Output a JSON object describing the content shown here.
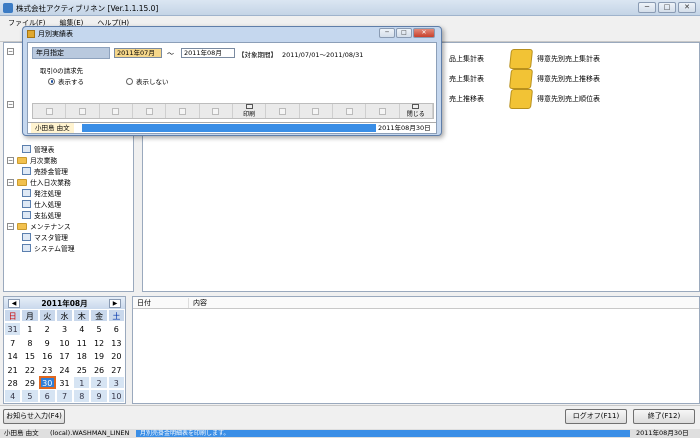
{
  "app": {
    "title": "株式会社アクティブリネン  [Ver.1.1.15.0]"
  },
  "window_controls": {
    "minimize": "─",
    "restore": "□",
    "close": "✕"
  },
  "menu": [
    {
      "label": "ファイル(F)"
    },
    {
      "label": "編集(E)"
    },
    {
      "label": "ヘルプ(H)"
    }
  ],
  "tree": {
    "items": [
      {
        "label": "管理表",
        "kind": "doc"
      },
      {
        "label": "月次業務",
        "kind": "folder"
      },
      {
        "label": "売掛金管理",
        "kind": "doc"
      },
      {
        "label": "仕入日次業務",
        "kind": "folder"
      },
      {
        "label": "発注処理",
        "kind": "doc"
      },
      {
        "label": "仕入処理",
        "kind": "doc"
      },
      {
        "label": "支払処理",
        "kind": "doc"
      },
      {
        "label": "メンテナンス",
        "kind": "folder"
      },
      {
        "label": "マスタ管理",
        "kind": "doc"
      },
      {
        "label": "システム管理",
        "kind": "doc"
      }
    ]
  },
  "reports": {
    "col1": [
      "品上集計表",
      "売上集計表",
      "売上推移表"
    ],
    "col2": [
      "得意先別売上集計表",
      "得意先別売上推移表",
      "得意先別売上順位表"
    ]
  },
  "calendar": {
    "month_label": "2011年08月",
    "prev": "◀",
    "next": "▶",
    "weekdays": [
      "日",
      "月",
      "火",
      "水",
      "木",
      "金",
      "土"
    ],
    "weeks": [
      [
        "31",
        "1",
        "2",
        "3",
        "4",
        "5",
        "6"
      ],
      [
        "7",
        "8",
        "9",
        "10",
        "11",
        "12",
        "13"
      ],
      [
        "14",
        "15",
        "16",
        "17",
        "18",
        "19",
        "20"
      ],
      [
        "21",
        "22",
        "23",
        "24",
        "25",
        "26",
        "27"
      ],
      [
        "28",
        "29",
        "30",
        "31",
        "1",
        "2",
        "3"
      ],
      [
        "4",
        "5",
        "6",
        "7",
        "8",
        "9",
        "10"
      ]
    ],
    "selected": "30"
  },
  "info": {
    "col_date": "日付",
    "col_content": "内容"
  },
  "bottom": {
    "notice_button": "お知らせ入力(F4)",
    "logout_button": "ログオフ(F11)",
    "exit_button": "終了(F12)"
  },
  "status": {
    "user": "小田島  由文",
    "server": "(local).WASHMAN_LINEN",
    "message": "月別売掛金明細表を印刷します。",
    "date": "2011年08月30日"
  },
  "dialog": {
    "title": "月別実績表",
    "period_label": "年月指定",
    "from_value": "2011年07月",
    "tilde": "～",
    "to_value": "2011年08月",
    "period_tag": "【対象期間】",
    "period_range": "2011/07/01～2011/08/31",
    "group_label": "取引0の請求先",
    "radio_show": "表示する",
    "radio_hide": "表示しない",
    "fkeys": [
      "",
      "",
      "",
      "",
      "",
      "",
      "印刷",
      "",
      "",
      "",
      "",
      "閉じる"
    ],
    "user": "小田島  由文",
    "date": "2011年08月30日"
  }
}
